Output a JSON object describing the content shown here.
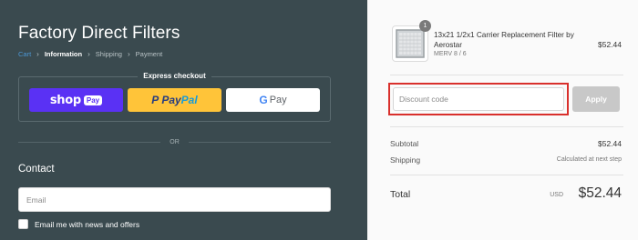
{
  "store": {
    "title": "Factory Direct Filters"
  },
  "breadcrumb": {
    "cart": "Cart",
    "information": "Information",
    "shipping": "Shipping",
    "payment": "Payment"
  },
  "express": {
    "label": "Express checkout",
    "shop_label": "shop",
    "shop_badge": "Pay",
    "paypal_pay": "Pay",
    "paypal_pal": "Pal",
    "gpay_g": "G",
    "gpay_label": "Pay"
  },
  "divider_or": "OR",
  "contact": {
    "heading": "Contact",
    "email_placeholder": "Email",
    "newsletter_label": "Email me with news and offers"
  },
  "order": {
    "quantity": "1",
    "product_name": "13x21 1/2x1 Carrier Replacement Filter by Aerostar",
    "product_variant": "MERV 8 / 6",
    "product_price": "$52.44",
    "discount_placeholder": "Discount code",
    "apply_label": "Apply",
    "subtotal_label": "Subtotal",
    "subtotal_value": "$52.44",
    "shipping_label": "Shipping",
    "shipping_value": "Calculated at next step",
    "total_label": "Total",
    "total_currency": "USD",
    "total_value": "$52.44"
  },
  "colors": {
    "left_background": "#3a4a4f",
    "shop_pay": "#5a31f4",
    "paypal": "#ffc439",
    "link": "#4c97d4",
    "highlight": "#d9302c"
  },
  "icons": [
    "chevron-right-icon",
    "filter-image"
  ]
}
